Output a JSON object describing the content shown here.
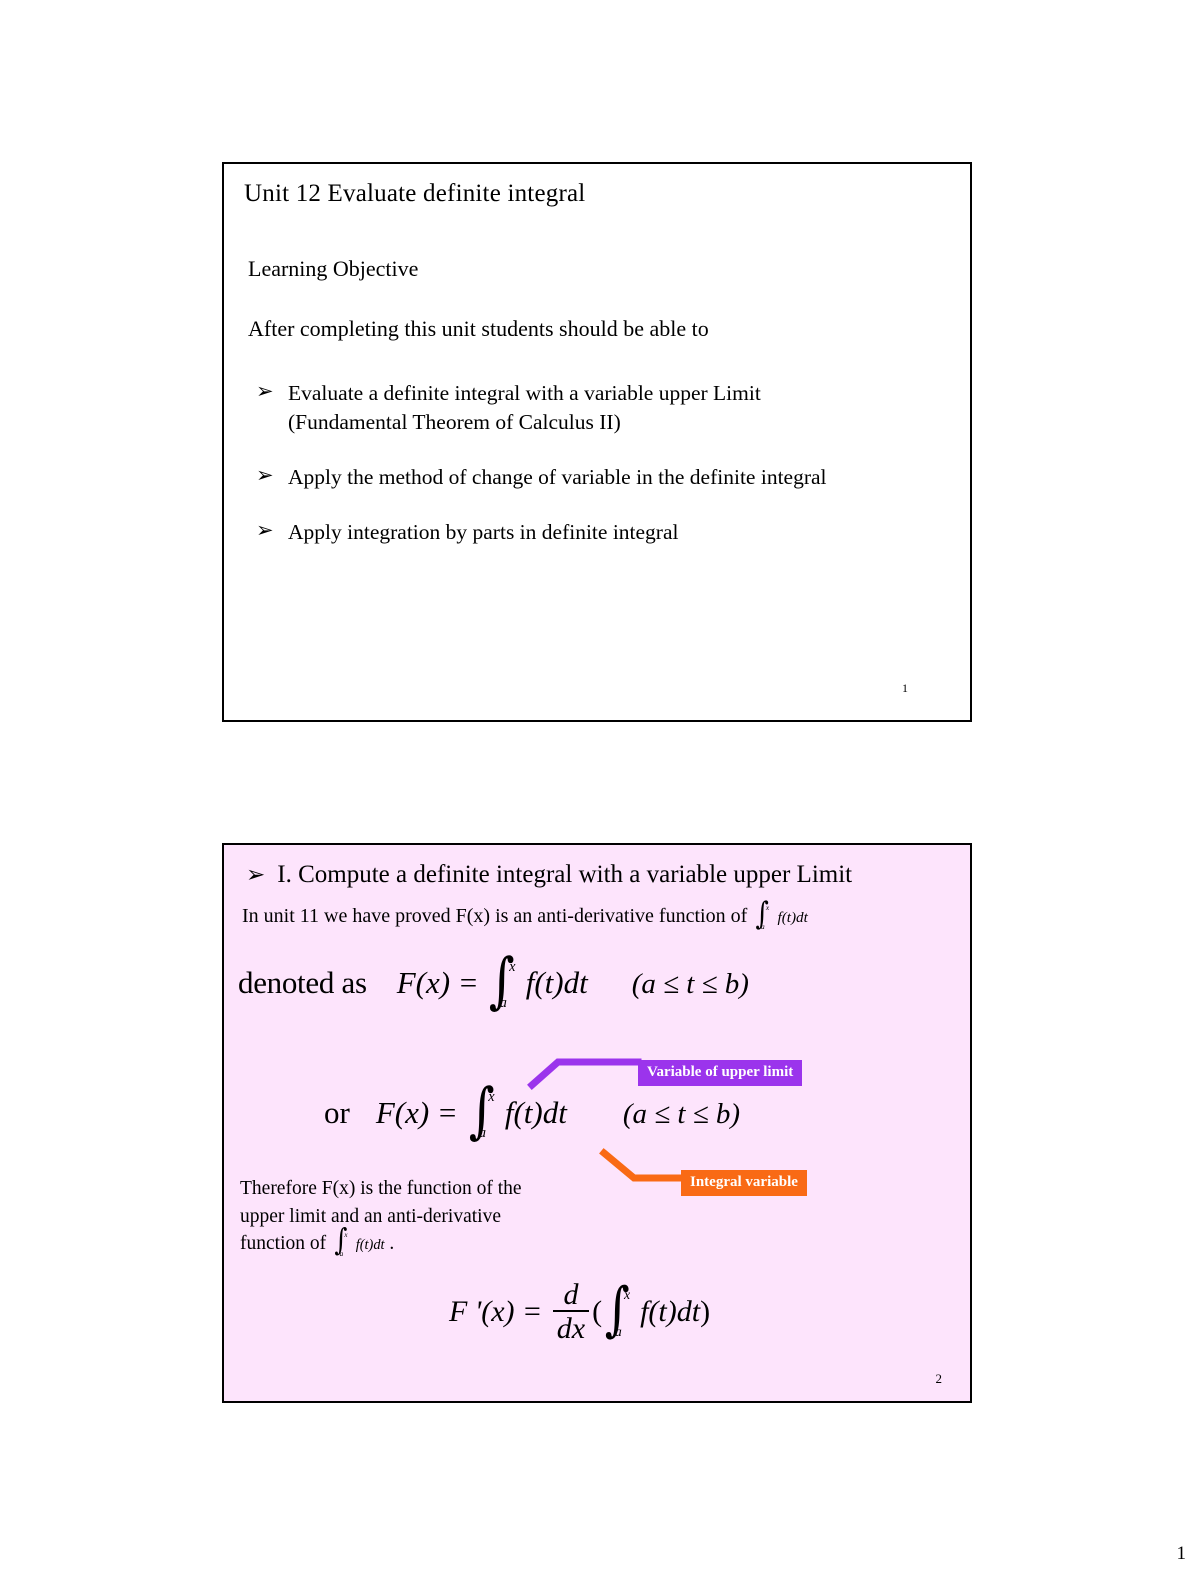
{
  "document": {
    "page_number": "1"
  },
  "slide1": {
    "title": "Unit 12  Evaluate definite integral",
    "learning_objective_heading": "Learning Objective",
    "intro_line": "After completing this unit students should be able to",
    "bullet_marker": "➢",
    "bullets": [
      {
        "line1": "Evaluate a definite integral with a variable upper Limit",
        "line2": "(Fundamental Theorem of Calculus II)"
      },
      {
        "line1": "Apply the method of  change of variable in the definite integral",
        "line2": ""
      },
      {
        "line1": "Apply integration by parts  in definite integral",
        "line2": ""
      }
    ],
    "page_number": "1",
    "background_color": "#ffffff",
    "border_color": "#000000"
  },
  "slide2": {
    "heading": "I. Compute a definite integral with a variable upper Limit",
    "bullet_marker": "➢",
    "subtitle_prefix": "In unit 11 we have proved F(x) is an anti-derivative function of",
    "equation_denoted": {
      "lead": "denoted as",
      "lhs": "F(x) =",
      "integral_lower": "a",
      "integral_upper": "x",
      "integrand": "f(t)dt",
      "condition": "(a ≤ t ≤ b)"
    },
    "equation_or": {
      "lead": "or",
      "lhs": "F(x) =",
      "integral_lower": "a",
      "integral_upper": "x",
      "integrand": "f(t)dt",
      "condition": "(a ≤ t ≤ b)"
    },
    "callout_upper_limit": {
      "label": "Variable of upper limit",
      "color": "#9b34ec",
      "text_color": "#ffffff"
    },
    "callout_integral_variable": {
      "label": "Integral variable",
      "color": "#f96a15",
      "text_color": "#ffffff"
    },
    "therefore_text": {
      "line1": "Therefore F(x) is the function of the",
      "line2": "upper limit and an anti-derivative",
      "line3_prefix": "function of",
      "line3_suffix": "."
    },
    "inline_integral": {
      "lower": "a",
      "upper": "x",
      "integrand": "f(t)dt"
    },
    "equation_derivative": {
      "lhs": "F '(x) =",
      "frac_num": "d",
      "frac_den": "dx",
      "open_paren": "(",
      "integral_lower": "a",
      "integral_upper": "x",
      "integrand": "f(t)dt",
      "close_paren": ")"
    },
    "page_number": "2",
    "background_color": "#fde4fc",
    "border_color": "#000000"
  }
}
